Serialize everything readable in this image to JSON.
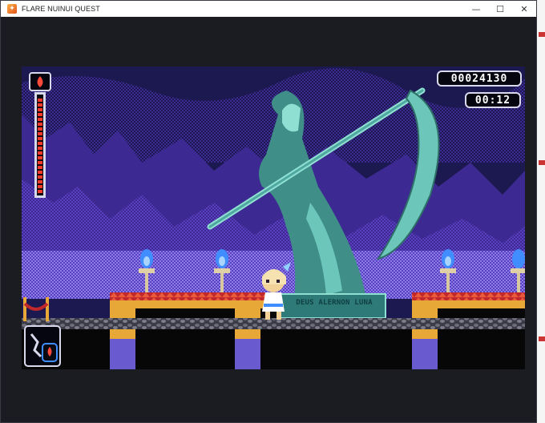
{
  "window": {
    "title": "FLARE NUINUI QUEST",
    "controls": {
      "minimize": "—",
      "maximize": "☐",
      "close": "✕"
    }
  },
  "hud": {
    "score": "00024130",
    "timer": "00:12",
    "health_fraction": 1.0,
    "health_icon": "flame-icon",
    "item_icon": "potion-flame-icon"
  },
  "scene": {
    "statue_inscription": "DEUS ALERNON LUNA",
    "palette": {
      "sky_deep": "#1c1850",
      "sky_mid": "#3c2a92",
      "sky_purple": "#5a3fc0",
      "horizon": "#8b7ee8",
      "statue": "#4fa8a0",
      "statue_light": "#8fe0d2",
      "platform_red": "#c0282c",
      "pillar_gold": "#e8a838",
      "pillar_purple": "#6a5ad0",
      "torch_blue": "#3f8dff"
    }
  }
}
